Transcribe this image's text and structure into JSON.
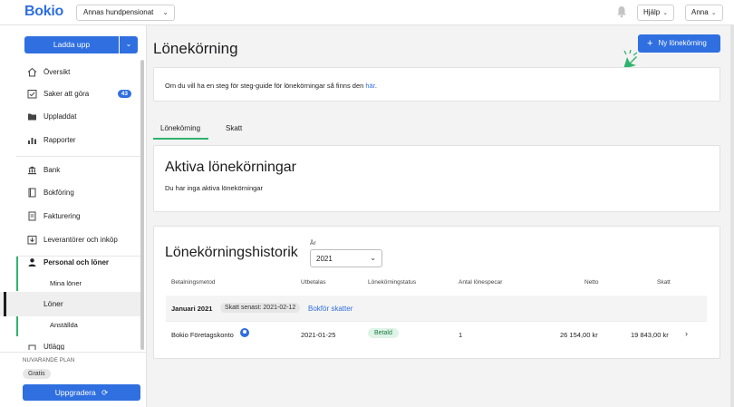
{
  "topbar": {
    "logo": "Bokio",
    "company": "Annas hundpensionat",
    "help": "Hjälp",
    "user": "Anna"
  },
  "sidebar": {
    "upload_label": "Ladda upp",
    "items": [
      {
        "label": "Översikt",
        "icon": "home-icon"
      },
      {
        "label": "Saker att göra",
        "icon": "checklist-icon",
        "badge": "43"
      },
      {
        "label": "Uppladdat",
        "icon": "folder-icon"
      },
      {
        "label": "Rapporter",
        "icon": "chart-icon"
      },
      {
        "label": "Bank",
        "icon": "bank-icon"
      },
      {
        "label": "Bokföring",
        "icon": "book-icon"
      },
      {
        "label": "Fakturering",
        "icon": "invoice-icon"
      },
      {
        "label": "Leverantörer och inköp",
        "icon": "download-box-icon"
      },
      {
        "label": "Personal och löner",
        "icon": "person-icon"
      },
      {
        "label": "Mina löner"
      },
      {
        "label": "Löner"
      },
      {
        "label": "Anställda"
      },
      {
        "label": "Utlägg",
        "icon": "receipt-icon"
      }
    ],
    "plan_label": "NUVARANDE PLAN",
    "plan_value": "Gratis",
    "upgrade_label": "Uppgradera"
  },
  "main": {
    "title": "Lönekörning",
    "new_button": "Ny lönekörning",
    "info_text": "Om du vill ha en steg för steg-guide för lönekörningar så finns den ",
    "info_link": "här",
    "info_end": ".",
    "tabs": [
      {
        "label": "Lönekörning",
        "active": true
      },
      {
        "label": "Skatt",
        "active": false
      }
    ],
    "active_title": "Aktiva lönekörningar",
    "active_text": "Du har inga aktiva lönekörningar",
    "history_title": "Lönekörningshistorik",
    "year_label": "År",
    "year_value": "2021",
    "columns": [
      "Betalningsmetod",
      "Utbetalas",
      "Lönekörningstatus",
      "Antal lönespecar",
      "Netto",
      "Skatt"
    ],
    "group": {
      "title": "Januari 2021",
      "tax_pill": "Skatt senast: 2021-02-12",
      "link": "Bokför skatter"
    },
    "rows": [
      {
        "method": "Bokio Företagskonto",
        "date": "2021-01-25",
        "status": "Betald",
        "count": "1",
        "net": "26 154,00 kr",
        "tax": "19 843,00 kr"
      }
    ]
  },
  "colors": {
    "primary": "#2f6fe0",
    "accent_green": "#2eb36e",
    "status_bg": "#dff3e7"
  }
}
